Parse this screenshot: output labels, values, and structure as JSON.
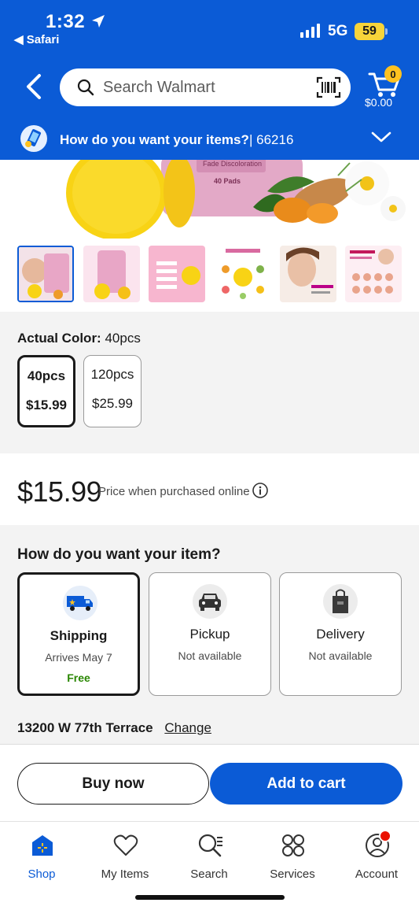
{
  "status_bar": {
    "time": "1:32",
    "back_app": "◀ Safari",
    "network": "5G",
    "battery": "59"
  },
  "header": {
    "search_placeholder": "Search Walmart",
    "cart_count": "0",
    "cart_total": "$0.00",
    "brand_color": "#0b5bd6"
  },
  "fulfillment_bar": {
    "question": "How do you want your items?",
    "zip": "| 66216"
  },
  "variant": {
    "label_prefix": "Actual Color:",
    "label_value": "40pcs",
    "options": [
      {
        "name": "40pcs",
        "price": "$15.99",
        "selected": true
      },
      {
        "name": "120pcs",
        "price": "$25.99",
        "selected": false
      }
    ]
  },
  "price": {
    "amount": "$15.99",
    "note": "Price when purchased online"
  },
  "fulfillment": {
    "title": "How do you want your item?",
    "options": [
      {
        "name": "Shipping",
        "status": "Arrives May 7",
        "extra": "Free",
        "selected": true,
        "icon": "truck-icon"
      },
      {
        "name": "Pickup",
        "status": "Not available",
        "selected": false,
        "icon": "car-icon"
      },
      {
        "name": "Delivery",
        "status": "Not available",
        "selected": false,
        "icon": "bag-icon"
      }
    ],
    "address": "13200 W 77th Terrace",
    "change_label": "Change"
  },
  "actions": {
    "buy_now": "Buy now",
    "add_to_cart": "Add to cart"
  },
  "tabs": [
    {
      "label": "Shop",
      "icon": "shop-icon",
      "active": true
    },
    {
      "label": "My Items",
      "icon": "heart-icon",
      "active": false
    },
    {
      "label": "Search",
      "icon": "search-icon",
      "active": false
    },
    {
      "label": "Services",
      "icon": "services-icon",
      "active": false
    },
    {
      "label": "Account",
      "icon": "account-icon",
      "active": false
    }
  ],
  "hero_image_text": {
    "line1": "Fade Discoloration",
    "line2": "40 Pads"
  }
}
